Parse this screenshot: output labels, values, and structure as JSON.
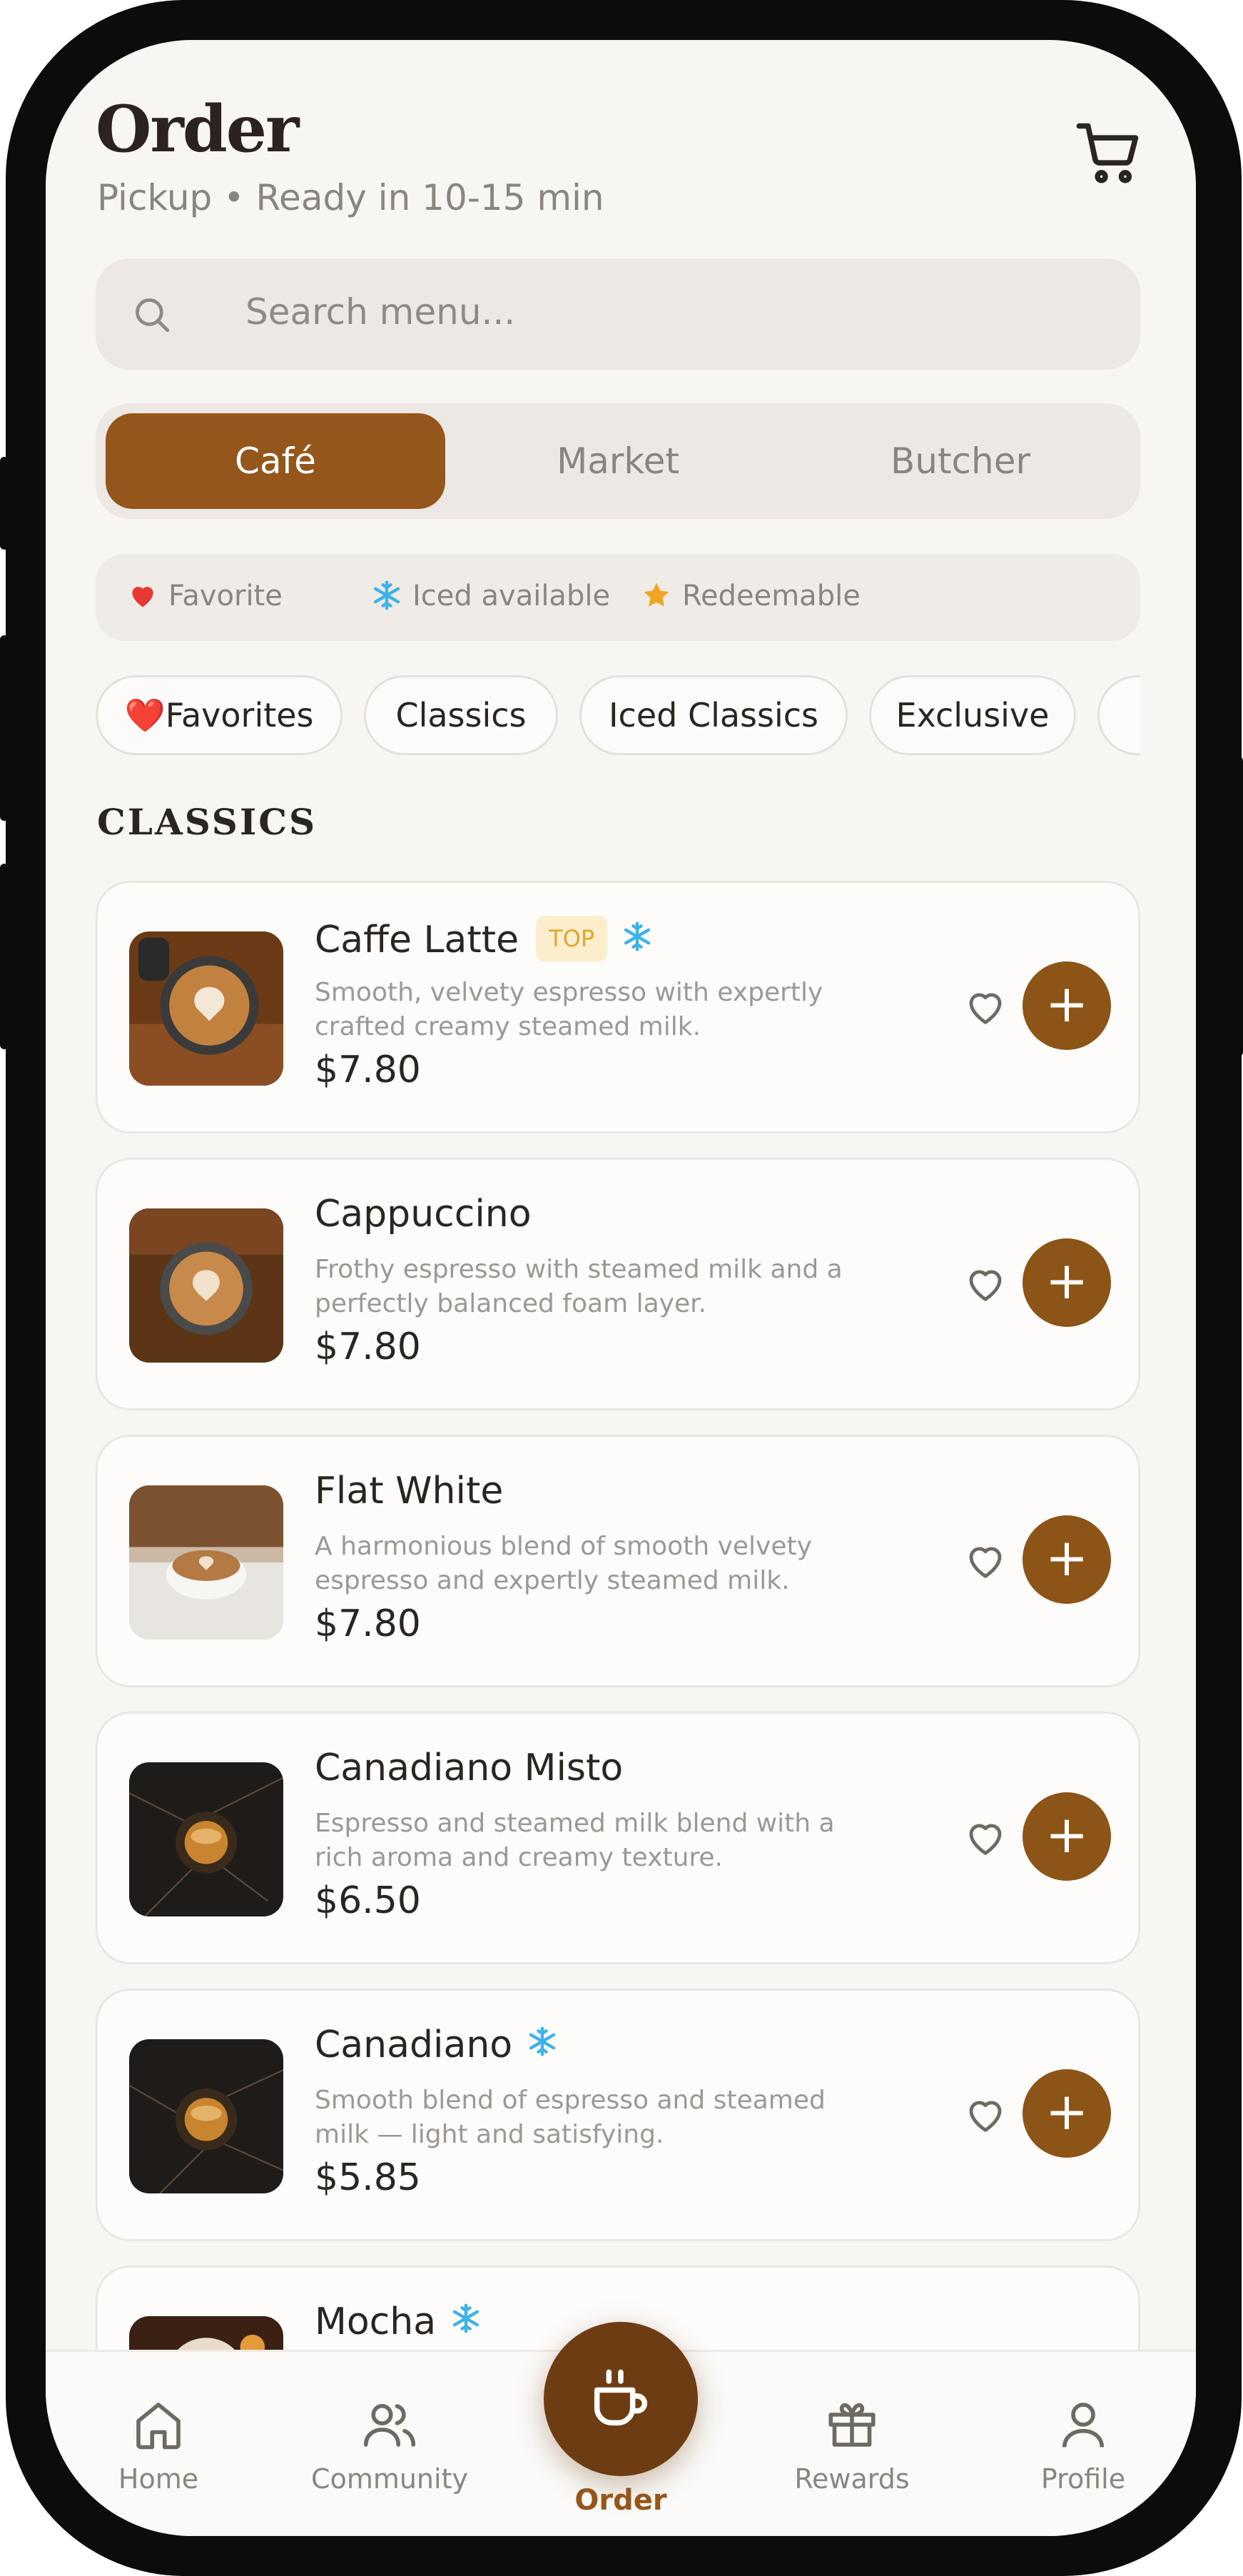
{
  "header": {
    "title": "Order",
    "subtitle": "Pickup • Ready in 10-15 min"
  },
  "search": {
    "placeholder": "Search menu..."
  },
  "segments": [
    {
      "label": "Café",
      "active": true
    },
    {
      "label": "Market",
      "active": false
    },
    {
      "label": "Butcher",
      "active": false
    }
  ],
  "legend": [
    {
      "icon": "heart-icon",
      "label": "Favorite"
    },
    {
      "icon": "snowflake-icon",
      "label": "Iced available"
    },
    {
      "icon": "star-icon",
      "label": "Redeemable"
    }
  ],
  "chips": [
    {
      "label": "Favorites",
      "emoji": "❤️"
    },
    {
      "label": "Classics"
    },
    {
      "label": "Iced Classics"
    },
    {
      "label": "Exclusive"
    }
  ],
  "section_title": "CLASSICS",
  "items": [
    {
      "name": "Caffe Latte",
      "badge": "TOP",
      "iced": true,
      "description": "Smooth, velvety espresso with expertly crafted creamy steamed milk.",
      "price": "$7.80"
    },
    {
      "name": "Cappuccino",
      "badge": "",
      "iced": false,
      "description": "Frothy espresso with steamed milk and a perfectly balanced foam layer.",
      "price": "$7.80"
    },
    {
      "name": "Flat White",
      "badge": "",
      "iced": false,
      "description": "A harmonious blend of smooth velvety espresso and expertly steamed milk.",
      "price": "$7.80"
    },
    {
      "name": "Canadiano Misto",
      "badge": "",
      "iced": false,
      "description": "Espresso and steamed milk blend with a rich aroma and creamy texture.",
      "price": "$6.50"
    },
    {
      "name": "Canadiano",
      "badge": "",
      "iced": true,
      "description": "Smooth blend of espresso and steamed milk — light and satisfying.",
      "price": "$5.85"
    },
    {
      "name": "Mocha",
      "badge": "",
      "iced": true,
      "description": "",
      "price": ""
    }
  ],
  "nav": [
    {
      "label": "Home",
      "icon": "home-icon"
    },
    {
      "label": "Community",
      "icon": "community-icon"
    },
    {
      "label": "Order",
      "icon": "coffee-cup-icon",
      "active": true
    },
    {
      "label": "Rewards",
      "icon": "gift-icon"
    },
    {
      "label": "Profile",
      "icon": "profile-icon"
    }
  ],
  "colors": {
    "accent": "#94561b",
    "accent_dark": "#6d3c12",
    "background": "#f8f6f3",
    "badge_bg": "#fcedcc",
    "badge_text": "#e3a52a",
    "iced": "#3fb3e8"
  }
}
